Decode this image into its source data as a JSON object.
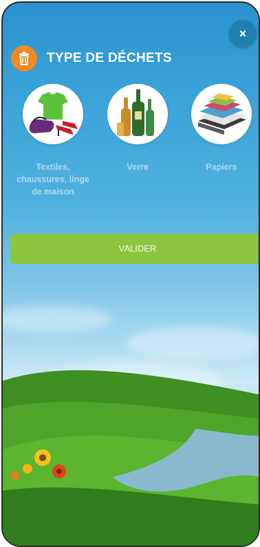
{
  "header": {
    "title": "TYPE DE DÉCHETS",
    "icon": "trash-icon"
  },
  "close": {
    "label": "×",
    "icon": "close-icon"
  },
  "types": [
    {
      "label": "Textiles, chaussures, linge de maison",
      "icon": "textiles-icon"
    },
    {
      "label": "Verre",
      "icon": "glass-bottles-icon"
    },
    {
      "label": "Papiers",
      "icon": "papers-icon"
    }
  ],
  "actions": {
    "validate_label": "VALIDER"
  },
  "colors": {
    "accent_orange": "#f08a24",
    "accent_green": "#8cc63f",
    "close_blue": "#1f7fb0"
  }
}
